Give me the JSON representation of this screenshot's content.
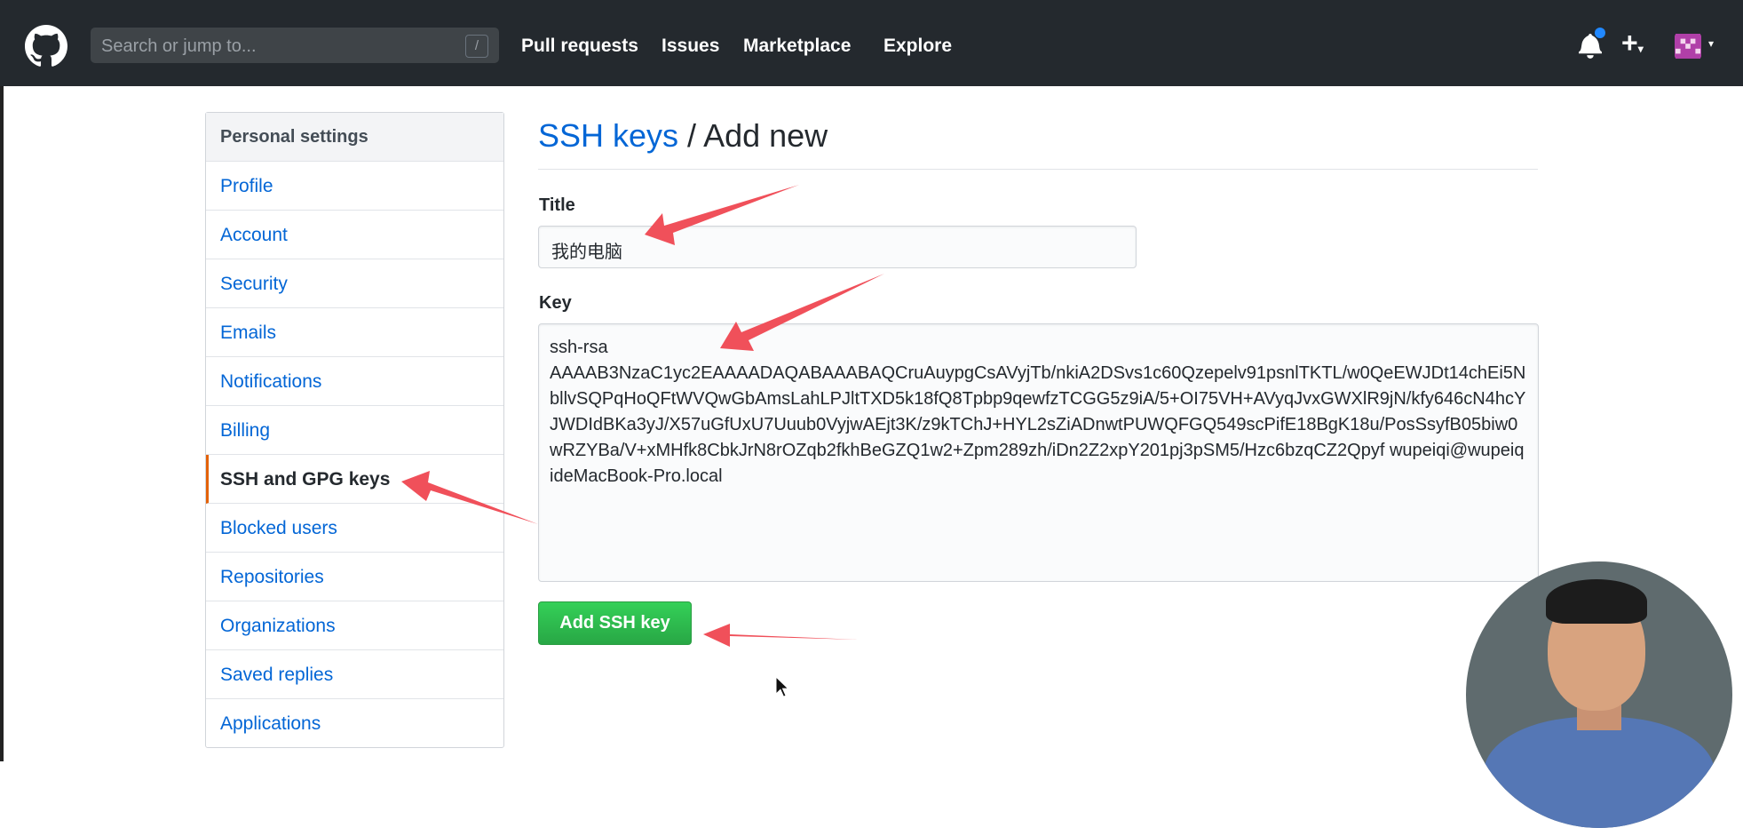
{
  "header": {
    "search_placeholder": "Search or jump to...",
    "search_shortcut": "/",
    "nav": [
      "Pull requests",
      "Issues",
      "Marketplace",
      "Explore"
    ],
    "plus_label": "+",
    "accent": "#2188ff"
  },
  "sidebar": {
    "heading": "Personal settings",
    "items": [
      {
        "label": "Profile"
      },
      {
        "label": "Account"
      },
      {
        "label": "Security"
      },
      {
        "label": "Emails"
      },
      {
        "label": "Notifications"
      },
      {
        "label": "Billing"
      },
      {
        "label": "SSH and GPG keys",
        "selected": true
      },
      {
        "label": "Blocked users"
      },
      {
        "label": "Repositories"
      },
      {
        "label": "Organizations"
      },
      {
        "label": "Saved replies"
      },
      {
        "label": "Applications"
      }
    ]
  },
  "main": {
    "breadcrumb_link": "SSH keys",
    "breadcrumb_sep": " / ",
    "breadcrumb_current": "Add new",
    "title_label": "Title",
    "title_value": "我的电脑",
    "key_label": "Key",
    "key_value": "ssh-rsa\nAAAAB3NzaC1yc2EAAAADAQABAAABAQCruAuypgCsAVyjTb/nkiA2DSvs1c60Qzepelv91psnlTKTL/w0QeEWJDt14chEi5NbllvSQPqHoQFtWVQwGbAmsLahLPJltTXD5k18fQ8Tpbp9qewfzTCGG5z9iA/5+OI75VH+AVyqJvxGWXlR9jN/kfy646cN4hcYJWDIdBKa3yJ/X57uGfUxU7Uuub0VyjwAEjt3K/z9kTChJ+HYL2sZiADnwtPUWQFGQ549scPifE18BgK18u/PosSsyfB05biw0wRZYBa/V+xMHfk8CbkJrN8rOZqb2fkhBeGZQ1w2+Zpm289zh/iDn2Z2xpY201pj3pSM5/Hzc6bzqCZ2Qpyf wupeiqi@wupeiqideMacBook-Pro.local",
    "submit_label": "Add SSH key",
    "button_color": "#28a745"
  }
}
